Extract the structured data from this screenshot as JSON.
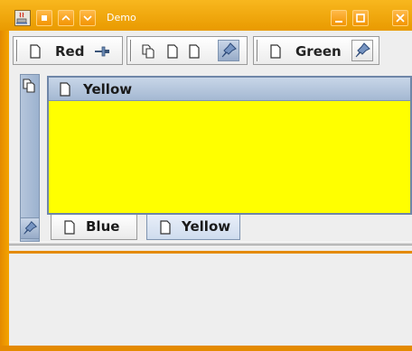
{
  "window": {
    "title": "Demo",
    "colors": {
      "frame": "#e48a00",
      "accent": "#f4a400",
      "content": "#eeeeee"
    }
  },
  "toolbar": {
    "red": {
      "label": "Red",
      "icon": "doc-icon",
      "pin_icon": "unpin-icon"
    },
    "middle": {
      "icons": [
        "cascade-icon",
        "doc-icon",
        "doc-icon",
        "pin-icon"
      ]
    },
    "green": {
      "label": "Green",
      "icon": "doc-icon",
      "pin_icon": "pin-icon"
    }
  },
  "rail": {
    "top_icon": "cascade-icon",
    "bottom_icon": "pin-icon"
  },
  "panel": {
    "title": "Yellow",
    "background": "#ffff00"
  },
  "tabs": [
    {
      "label": "Blue",
      "icon": "doc-icon",
      "active": false
    },
    {
      "label": "Yellow",
      "icon": "doc-icon",
      "active": true
    }
  ]
}
